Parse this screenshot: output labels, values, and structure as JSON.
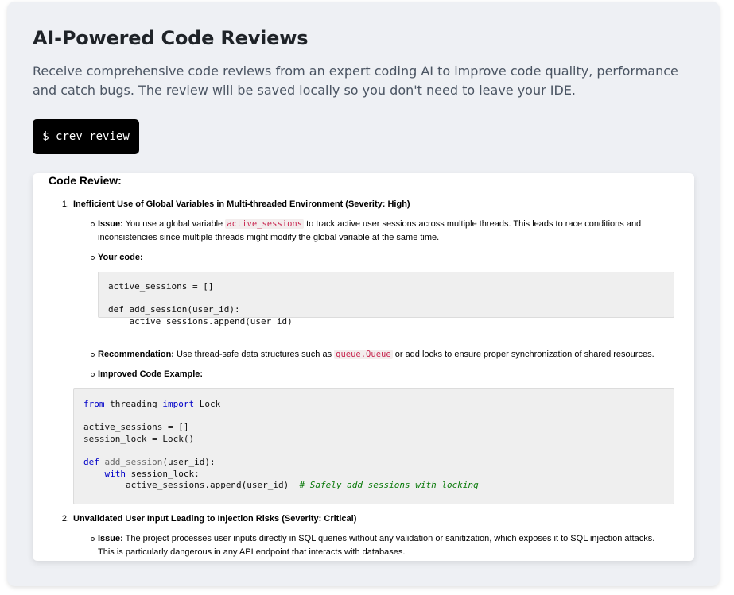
{
  "header": {
    "title": "AI-Powered Code Reviews",
    "description": "Receive comprehensive code reviews from an expert coding AI to improve code quality, performance and catch bugs. The review will be saved locally so you don't need to leave your IDE."
  },
  "command": {
    "text": "$ crev review"
  },
  "review": {
    "heading": "Code Review:",
    "items": [
      {
        "number": "1.",
        "title": "Inefficient Use of Global Variables in Multi-threaded Environment (Severity: High)",
        "issue_label": "Issue:",
        "issue_pre": " You use a global variable ",
        "issue_code": "active_sessions",
        "issue_post_line1": " to track active user sessions across multiple threads. This leads to race conditions and",
        "issue_line2": "inconsistencies since multiple threads might modify the global variable at the same time.",
        "your_code_label": "Your code:",
        "your_code": "active_sessions = []\n\ndef add_session(user_id):\n    active_sessions.append(user_id)",
        "recommendation_label": "Recommendation:",
        "recommendation_pre": " Use thread-safe data structures such as ",
        "recommendation_code": "queue.Queue",
        "recommendation_post": " or add locks to ensure proper synchronization of shared resources.",
        "improved_label": "Improved Code Example:",
        "improved_code": {
          "l1_kw1": "from",
          "l1_mid": " threading ",
          "l1_kw2": "import",
          "l1_end": " Lock",
          "l3": "active_sessions = []",
          "l4": "session_lock = Lock()",
          "l6_kw": "def",
          "l6_fn": "add_session",
          "l6_end": "(user_id):",
          "l7_kw": "with",
          "l7_end": " session_lock:",
          "l8_code": "active_sessions.append(user_id)",
          "l8_comment": "# Safely add sessions with locking"
        }
      },
      {
        "number": "2.",
        "title": "Unvalidated User Input Leading to Injection Risks (Severity: Critical)",
        "issue_label": "Issue:",
        "issue_line1": " The project processes user inputs directly in SQL queries without any validation or sanitization, which exposes it to SQL injection attacks.",
        "issue_line2": "This is particularly dangerous in any API endpoint that interacts with databases."
      }
    ]
  }
}
